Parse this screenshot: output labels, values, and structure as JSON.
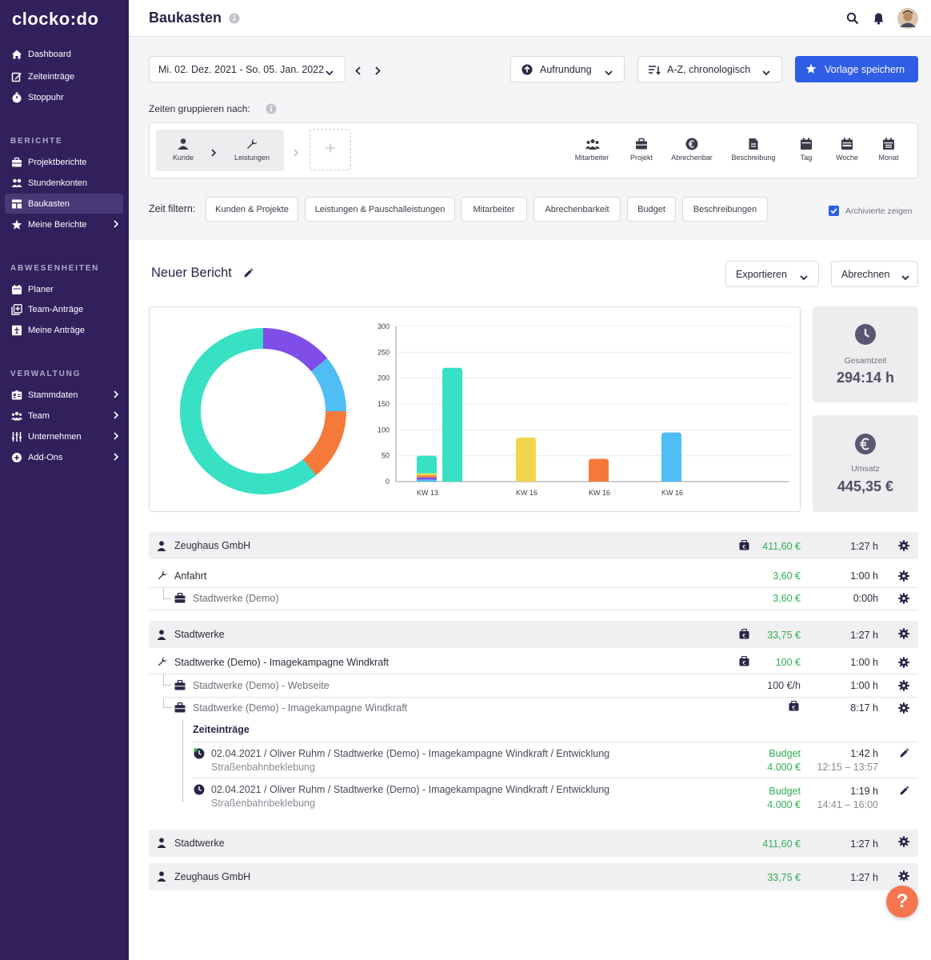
{
  "brand": "clocko:do",
  "sidebar": {
    "top": [
      {
        "label": "Dashboard",
        "icon": "home-icon"
      },
      {
        "label": "Zeiteinträge",
        "icon": "edit-icon"
      },
      {
        "label": "Stoppuhr",
        "icon": "stopwatch-icon"
      }
    ],
    "reports_head": "BERICHTE",
    "reports": [
      {
        "label": "Projektberichte",
        "icon": "briefcase-icon"
      },
      {
        "label": "Stundenkonten",
        "icon": "people-icon"
      },
      {
        "label": "Baukasten",
        "icon": "layout-icon",
        "active": true
      },
      {
        "label": "Meine Berichte",
        "icon": "star-icon"
      }
    ],
    "absences_head": "ABWESENHEITEN",
    "absences": [
      {
        "label": "Planer",
        "icon": "calendar-icon"
      },
      {
        "label": "Team-Anträge",
        "icon": "team-request-icon"
      },
      {
        "label": "Meine Anträge",
        "icon": "flight-icon"
      }
    ],
    "admin_head": "VERWALTUNG",
    "admin": [
      {
        "label": "Stammdaten",
        "icon": "id-card-icon"
      },
      {
        "label": "Team",
        "icon": "group-icon"
      },
      {
        "label": "Unternehmen",
        "icon": "sliders-icon"
      },
      {
        "label": "Add-Ons",
        "icon": "plus-circle-icon"
      }
    ]
  },
  "header": {
    "title": "Baukasten"
  },
  "toolbar": {
    "date_range": "Mi. 02. Dez. 2021 - So. 05. Jan. 2022",
    "rounding": "Aufrundung",
    "sort": "A-Z, chronologisch",
    "save_template": "Vorlage speichern"
  },
  "grouping": {
    "label": "Zeiten gruppieren nach:",
    "selected": [
      "Kunde",
      "Leistungen"
    ],
    "options": [
      "Mitarbeiter",
      "Projekt",
      "Abrechenbar",
      "Beschreibung",
      "Tag",
      "Woche",
      "Monat"
    ]
  },
  "filter": {
    "label": "Zeit filtern:",
    "chips": [
      "Kunden & Projekte",
      "Leistungen & Pauschalleistungen",
      "Mitarbeiter",
      "Abrechenbarkeit",
      "Budget",
      "Beschreibungen"
    ],
    "archived": "Archivierte zeigen"
  },
  "report": {
    "title": "Neuer Bericht",
    "export": "Exportieren",
    "bill": "Abrechnen"
  },
  "stats": {
    "total_label": "Gesamtzeit",
    "total_value": "294:14 h",
    "revenue_label": "Umsatz",
    "revenue_value": "445,35 €"
  },
  "chart_data": [
    {
      "type": "pie",
      "donut": true,
      "values": [
        14,
        11,
        14,
        61
      ],
      "colors": [
        "#7e4ee6",
        "#4ebef5",
        "#f57a3a",
        "#38e0c4"
      ]
    },
    {
      "type": "bar",
      "yticks": [
        0,
        50,
        100,
        150,
        200,
        250,
        300
      ],
      "ylim": [
        0,
        300
      ],
      "categories": [
        "KW 13",
        "KW 16",
        "KW 16",
        "KW 16"
      ],
      "bars": [
        {
          "category": 0,
          "stack": [
            {
              "value": 4,
              "color": "#4ebef5"
            },
            {
              "value": 4,
              "color": "#7e4ee6"
            },
            {
              "value": 4,
              "color": "#f57a3a"
            },
            {
              "value": 4,
              "color": "#f2d54e"
            },
            {
              "value": 34,
              "color": "#38e0c4"
            }
          ]
        },
        {
          "category": 0,
          "stack": [
            {
              "value": 220,
              "color": "#38e0c4"
            }
          ]
        },
        {
          "category": 1,
          "stack": [
            {
              "value": 85,
              "color": "#f2d54e"
            }
          ]
        },
        {
          "category": 2,
          "stack": [
            {
              "value": 44,
              "color": "#f57a3a"
            }
          ]
        },
        {
          "category": 3,
          "stack": [
            {
              "value": 95,
              "color": "#4ebef5"
            }
          ]
        }
      ]
    }
  ],
  "rows": {
    "r1": {
      "name": "Zeughaus GmbH",
      "amount": "411,60 €",
      "time": "1:27 h"
    },
    "r2": {
      "name": "Anfahrt",
      "amount": "3,60 €",
      "time": "1:00 h"
    },
    "r3": {
      "name": "Stadtwerke (Demo)",
      "amount": "3,60 €",
      "time": "0:00h"
    },
    "r4": {
      "name": "Stadtwerke",
      "amount": "33,75 €",
      "time": "1:27 h"
    },
    "r5": {
      "name": "Stadtwerke (Demo) - Imagekampagne Windkraft",
      "amount": "100 €",
      "time": "1:00 h"
    },
    "r6": {
      "name": "Stadtwerke (Demo) - Webseite",
      "amount": "100 €/h",
      "time": "1:00 h"
    },
    "r7": {
      "name": "Stadtwerke (Demo) - Imagekampagne Windkraft",
      "time": "8:17 h"
    },
    "entries_head": "Zeiteinträge",
    "e1": {
      "title": "02.04.2021 / Oliver Ruhm / Stadtwerke (Demo) - Imagekampagne Windkraft / Entwicklung",
      "sub": "Straßenbahnbeklebung",
      "budget": "Budget",
      "budget_value": "4.000 €",
      "time": "1:42 h",
      "range": "12:15 – 13:57"
    },
    "e2": {
      "title": "02.04.2021 / Oliver Ruhm / Stadtwerke (Demo) - Imagekampagne Windkraft / Entwicklung",
      "sub": "Straßenbahnbeklebung",
      "budget": "Budget",
      "budget_value": "4.000 €",
      "time": "1:19 h",
      "range": "14:41 – 16:00"
    },
    "r8": {
      "name": "Stadtwerke",
      "amount": "411,60 €",
      "time": "1:27 h"
    },
    "r9": {
      "name": "Zeughaus GmbH",
      "amount": "33,75 €",
      "time": "1:27 h"
    }
  },
  "help": "?"
}
